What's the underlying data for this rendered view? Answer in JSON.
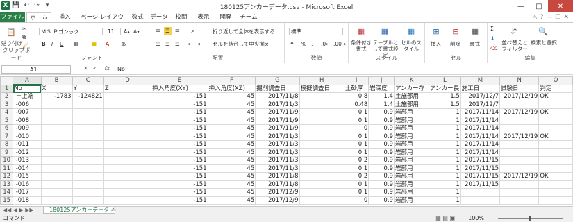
{
  "window": {
    "title": "180125アンカーデータ.csv - Microsoft Excel"
  },
  "tabs": [
    "ファイル",
    "ホーム",
    "挿入",
    "ページ レイアウト",
    "数式",
    "データ",
    "校閲",
    "表示",
    "開発",
    "チーム"
  ],
  "ribbon": {
    "clipboard": {
      "label": "クリップボード",
      "paste": "貼り付け"
    },
    "font": {
      "label": "フォント",
      "name": "ＭＳ Ｐゴシック",
      "size": "11"
    },
    "alignment": {
      "label": "配置",
      "wrap": "折り返して全体を表示する",
      "merge": "セルを結合して中央揃え"
    },
    "number": {
      "label": "数値",
      "format": "標準"
    },
    "styles": {
      "label": "スタイル",
      "cond": "条件付き書式",
      "table": "テーブルとして書式設定",
      "cell": "セルのスタイル"
    },
    "cells": {
      "label": "セル",
      "insert": "挿入",
      "delete": "削除",
      "format": "書式"
    },
    "editing": {
      "label": "編集",
      "sort": "並べ替えとフィルター",
      "find": "検索と選択"
    }
  },
  "formula": {
    "name_box": "A1",
    "fx": "fx",
    "value": "No"
  },
  "grid": {
    "columns": [
      "A",
      "B",
      "C",
      "D",
      "E",
      "F",
      "G",
      "H",
      "I",
      "J",
      "K",
      "L",
      "M",
      "N",
      "O"
    ],
    "rows": [
      [
        "No",
        "X",
        "Y",
        "Z",
        "挿入角度(XY)",
        "挿入角度(XZ)",
        "掘削調査日",
        "模擬調査日",
        "土砂厚",
        "岩深度",
        "アンカー存",
        "アンカー長",
        "施工日",
        "試験日",
        "判定"
      ],
      [
        "I－上端",
        "-1783",
        "-124821",
        "",
        "-151",
        "45",
        "2017/11/8",
        "",
        "0.8",
        "1.4",
        "土施部用",
        "1.5",
        "2017/12/7",
        "2017/12/19",
        "OK"
      ],
      [
        "I-006",
        "",
        "",
        "",
        "-151",
        "45",
        "2017/11/3",
        "",
        "0.48",
        "1.4",
        "土施部用",
        "1.5",
        "2017/12/7",
        "",
        ""
      ],
      [
        "I-007",
        "",
        "",
        "",
        "-151",
        "45",
        "2017/11/9",
        "",
        "0.1",
        "0.9",
        "岩部用",
        "1",
        "2017/11/14",
        "2017/12/19",
        "OK"
      ],
      [
        "I-008",
        "",
        "",
        "",
        "-151",
        "45",
        "2017/11/9",
        "",
        "0.1",
        "0.9",
        "岩部用",
        "1",
        "2017/11/14",
        "",
        ""
      ],
      [
        "I-009",
        "",
        "",
        "",
        "-151",
        "45",
        "2017/11/9",
        "",
        "0",
        "0.9",
        "岩部用",
        "1",
        "2017/11/14",
        "",
        ""
      ],
      [
        "I-010",
        "",
        "",
        "",
        "-151",
        "45",
        "2017/11/3",
        "",
        "0.1",
        "0.9",
        "岩部用",
        "1",
        "2017/11/14",
        "2017/12/19",
        "OK"
      ],
      [
        "I-011",
        "",
        "",
        "",
        "-151",
        "45",
        "2017/11/3",
        "",
        "0.1",
        "0.9",
        "岩部用",
        "1",
        "2017/11/14",
        "",
        ""
      ],
      [
        "I-012",
        "",
        "",
        "",
        "-151",
        "45",
        "2017/11/3",
        "",
        "0.1",
        "0.9",
        "岩部用",
        "1",
        "2017/11/14",
        "",
        ""
      ],
      [
        "I-013",
        "",
        "",
        "",
        "-151",
        "45",
        "2017/11/3",
        "",
        "0.2",
        "0.9",
        "岩部用",
        "1",
        "2017/11/15",
        "",
        ""
      ],
      [
        "I-014",
        "",
        "",
        "",
        "-151",
        "45",
        "2017/11/3",
        "",
        "0.1",
        "0.9",
        "岩部用",
        "1",
        "2017/11/15",
        "",
        ""
      ],
      [
        "I-015",
        "",
        "",
        "",
        "-151",
        "45",
        "2017/11/8",
        "",
        "0.2",
        "0.9",
        "岩部用",
        "1",
        "2017/11/15",
        "2017/12/19",
        "OK"
      ],
      [
        "I-016",
        "",
        "",
        "",
        "-151",
        "45",
        "2017/11/8",
        "",
        "0.1",
        "0.9",
        "岩部用",
        "1",
        "2017/11/15",
        "",
        ""
      ],
      [
        "I-017",
        "",
        "",
        "",
        "-151",
        "45",
        "2017/12/9",
        "",
        "0.1",
        "0.9",
        "岩部用",
        "1",
        "",
        "",
        ""
      ],
      [
        "I-018",
        "",
        "",
        "",
        "-151",
        "45",
        "2017/12/9",
        "",
        "0",
        "0.9",
        "岩部用",
        "1",
        "",
        "",
        ""
      ]
    ]
  },
  "sheet": {
    "tab": "180125アンカーデータ"
  },
  "status": {
    "left": "コマンド",
    "zoom": "100%"
  }
}
